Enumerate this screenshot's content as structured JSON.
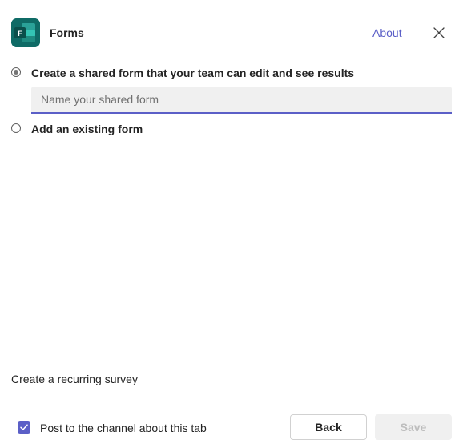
{
  "header": {
    "app_name": "Forms",
    "app_icon": "forms-app-icon",
    "app_icon_letter": "F",
    "about_label": "About",
    "close_icon": "close-icon"
  },
  "options": {
    "create_shared": {
      "label": "Create a shared form that your team can edit and see results",
      "selected": true,
      "name_input": {
        "placeholder": "Name your shared form",
        "value": ""
      }
    },
    "add_existing": {
      "label": "Add an existing form",
      "selected": false
    }
  },
  "footer": {
    "recurring_survey_label": "Create a recurring survey",
    "post_to_channel": {
      "label": "Post to the channel about this tab",
      "checked": true
    },
    "back_label": "Back",
    "save_label": "Save",
    "save_enabled": false
  },
  "colors": {
    "accent": "#5b5fc7",
    "forms_icon_bg": "#0f6b66",
    "disabled_text": "#bdbdbd"
  }
}
